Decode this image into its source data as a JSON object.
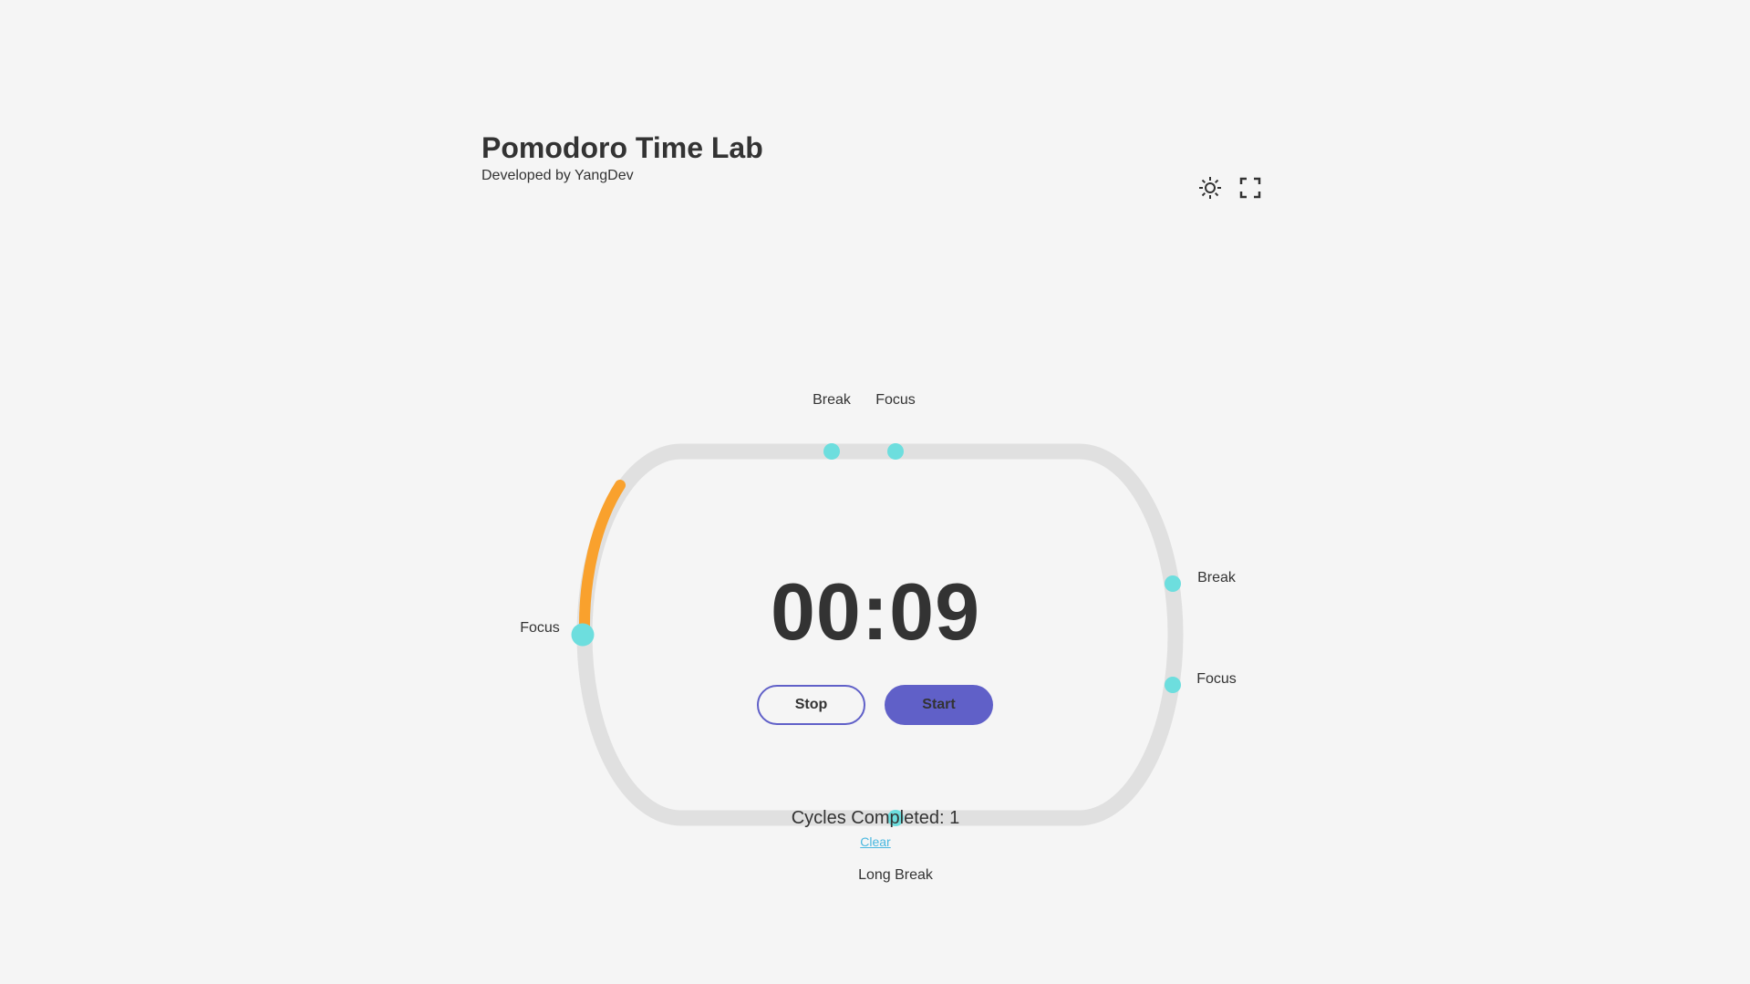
{
  "header": {
    "title": "Pomodoro Time Lab",
    "subtitle": "Developed by YangDev"
  },
  "icons": {
    "theme": "sun-icon",
    "fullscreen": "fullscreen-icon"
  },
  "timer": {
    "display": "00:09",
    "progress_current_segment": 0.3,
    "markers": [
      {
        "label": "Focus",
        "position": "left",
        "active": true
      },
      {
        "label": "Break",
        "position": "top-left"
      },
      {
        "label": "Focus",
        "position": "top-right"
      },
      {
        "label": "Break",
        "position": "right-upper"
      },
      {
        "label": "Focus",
        "position": "right-lower"
      },
      {
        "label": "Long Break",
        "position": "bottom"
      }
    ]
  },
  "controls": {
    "stop_label": "Stop",
    "start_label": "Start"
  },
  "stats": {
    "cycles_text": "Cycles Completed: 1",
    "clear_label": "Clear"
  },
  "colors": {
    "background": "#f5f5f5",
    "track": "#e0e0e0",
    "marker": "#6ddede",
    "progress": "#f9a12d",
    "accent": "#6060c8",
    "link": "#4ab8e0"
  }
}
